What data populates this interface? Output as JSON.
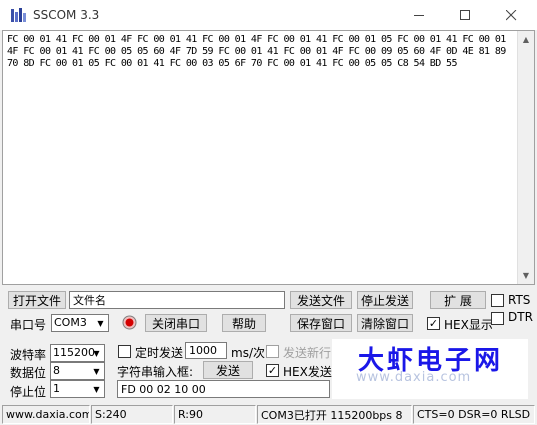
{
  "window": {
    "title": "SSCOM 3.3"
  },
  "receive": {
    "text": "FC 00 01 41 FC 00 01 4F FC 00 01 41 FC 00 01 4F FC 00 01 41 FC 00 01 05 FC 00 01 41 FC 00 01 4F FC 00 01 41 FC 00 05 05 60 4F 7D 59 FC 00 01 41 FC 00 01 4F FC 00 09 05 60 4F 0D 4E 81 89 70 8D FC 00 01 05 FC 00 01 41 FC 00 03 05 6F 70 FC 00 01 41 FC 00 05 05 C8 54 BD 55"
  },
  "row1": {
    "open_file": "打开文件",
    "file_name": "文件名",
    "send_file": "发送文件",
    "stop_send": "停止发送",
    "expand": "扩 展",
    "rts": "RTS"
  },
  "row2": {
    "port_label": "串口号",
    "port_value": "COM3",
    "close_port": "关闭串口",
    "help": "帮助",
    "save_window": "保存窗口",
    "clear_window": "清除窗口",
    "hex_display": "HEX显示",
    "dtr": "DTR"
  },
  "settings": {
    "baud_label": "波特率",
    "baud_value": "115200",
    "data_bits_label": "数据位",
    "data_bits_value": "8",
    "stop_bits_label": "停止位",
    "stop_bits_value": "1",
    "timed_send": "定时发送",
    "interval": "1000",
    "interval_unit": "ms/次",
    "send_newline": "发送新行",
    "string_input_label": "字符串输入框:",
    "send": "发送",
    "hex_send": "HEX发送",
    "send_input": "FD 00 02 10 00"
  },
  "brand": {
    "name": "大虾电子网",
    "watermark": "www.daxia.com"
  },
  "status": {
    "website": "www.daxia.com",
    "s_count": "S:240",
    "r_count": "R:90",
    "port_status": "COM3已打开  115200bps  8",
    "lines": "CTS=0 DSR=0 RLSD"
  },
  "checks": {
    "timed_send": false,
    "send_newline": false,
    "hex_send": true,
    "hex_display": true,
    "rts": false,
    "dtr": false
  },
  "colors": {
    "brand": "#1a17e8",
    "port_indicator": "#d40000"
  }
}
